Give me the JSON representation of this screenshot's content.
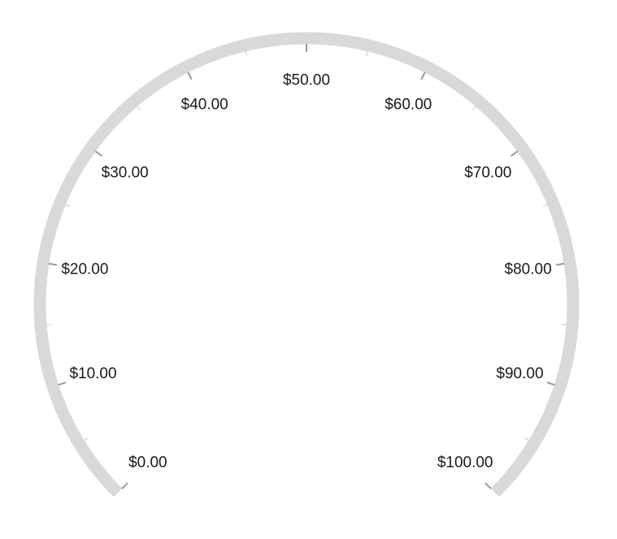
{
  "chart_data": {
    "type": "radial-gauge",
    "scale": {
      "min": 0,
      "max": 100,
      "start_angle_deg": 225,
      "end_angle_deg": -45,
      "major_interval": 10,
      "minor_interval": 5
    },
    "ticks": [
      {
        "value": 0,
        "label": "$0.00"
      },
      {
        "value": 10,
        "label": "$10.00"
      },
      {
        "value": 20,
        "label": "$20.00"
      },
      {
        "value": 30,
        "label": "$30.00"
      },
      {
        "value": 40,
        "label": "$40.00"
      },
      {
        "value": 50,
        "label": "$50.00"
      },
      {
        "value": 60,
        "label": "$60.00"
      },
      {
        "value": 70,
        "label": "$70.00"
      },
      {
        "value": 80,
        "label": "$80.00"
      },
      {
        "value": 90,
        "label": "$90.00"
      },
      {
        "value": 100,
        "label": "$100.00"
      }
    ],
    "colors": {
      "track": "#d9d9d9",
      "major_tick": "#999999",
      "minor_tick": "#c8c8c8",
      "label": "#1a1a1a"
    }
  }
}
